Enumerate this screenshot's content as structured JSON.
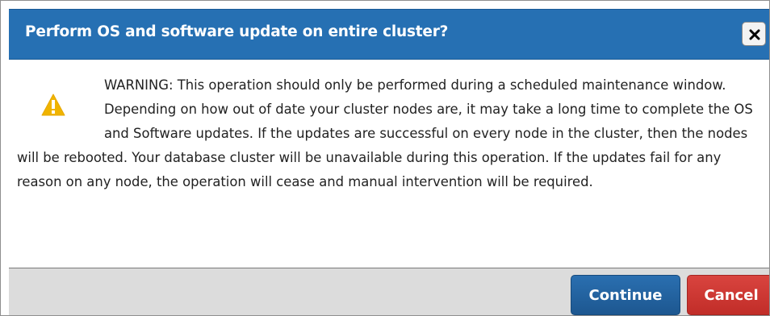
{
  "dialog": {
    "title": "Perform OS and software update on entire cluster?",
    "close_icon": "close-icon",
    "warning_icon": "warning-triangle-icon",
    "message": "WARNING:  This operation should only be performed during a scheduled maintenance window. Depending on how out of date your cluster nodes are, it may take a long time to complete the OS and Software updates. If the updates are successful on every node in the cluster, then the nodes will be rebooted. Your database cluster will be unavailable during this operation. If the updates fail for any reason on any node, the operation will cease and manual intervention will be required."
  },
  "footer": {
    "continue_label": "Continue",
    "cancel_label": "Cancel"
  },
  "colors": {
    "titlebar": "#2670b3",
    "warning": "#f0b400",
    "continue": "#1f5f9c",
    "cancel": "#cf3833",
    "footer": "#dcdcdc"
  }
}
